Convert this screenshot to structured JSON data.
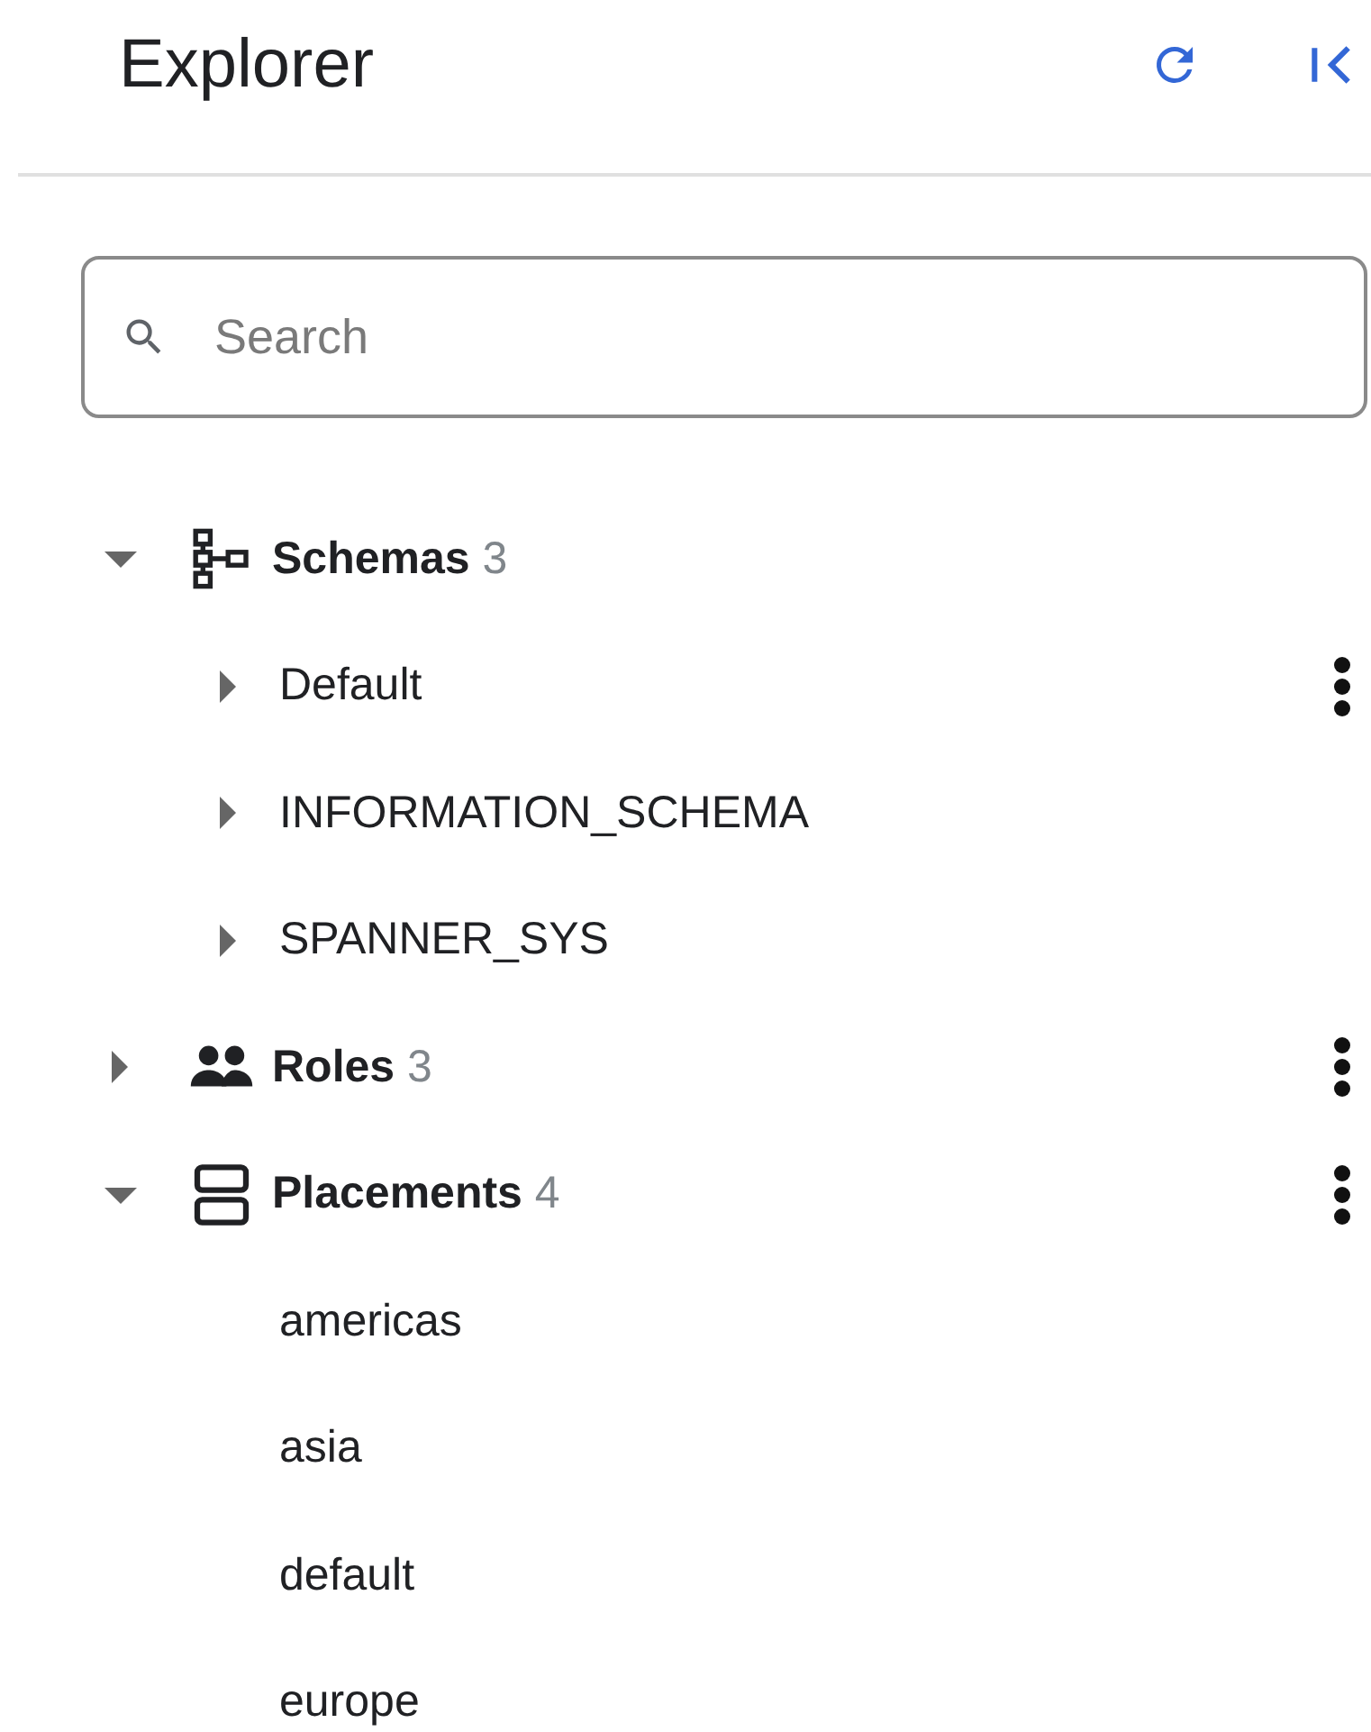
{
  "header": {
    "title": "Explorer"
  },
  "search": {
    "placeholder": "Search"
  },
  "tree": [
    {
      "kind": "schemas",
      "label": "Schemas",
      "count": "3",
      "expanded": true,
      "menu": false,
      "children": [
        {
          "label": "Default",
          "expanded": false,
          "menu": true
        },
        {
          "label": "INFORMATION_SCHEMA",
          "expanded": false,
          "menu": false
        },
        {
          "label": "SPANNER_SYS",
          "expanded": false,
          "menu": false
        }
      ]
    },
    {
      "kind": "roles",
      "label": "Roles",
      "count": "3",
      "expanded": false,
      "menu": true
    },
    {
      "kind": "placements",
      "label": "Placements",
      "count": "4",
      "expanded": true,
      "menu": true,
      "children": [
        {
          "label": "americas",
          "menu": false
        },
        {
          "label": "asia",
          "menu": false
        },
        {
          "label": "default",
          "menu": false
        },
        {
          "label": "europe",
          "menu": false
        }
      ]
    }
  ]
}
